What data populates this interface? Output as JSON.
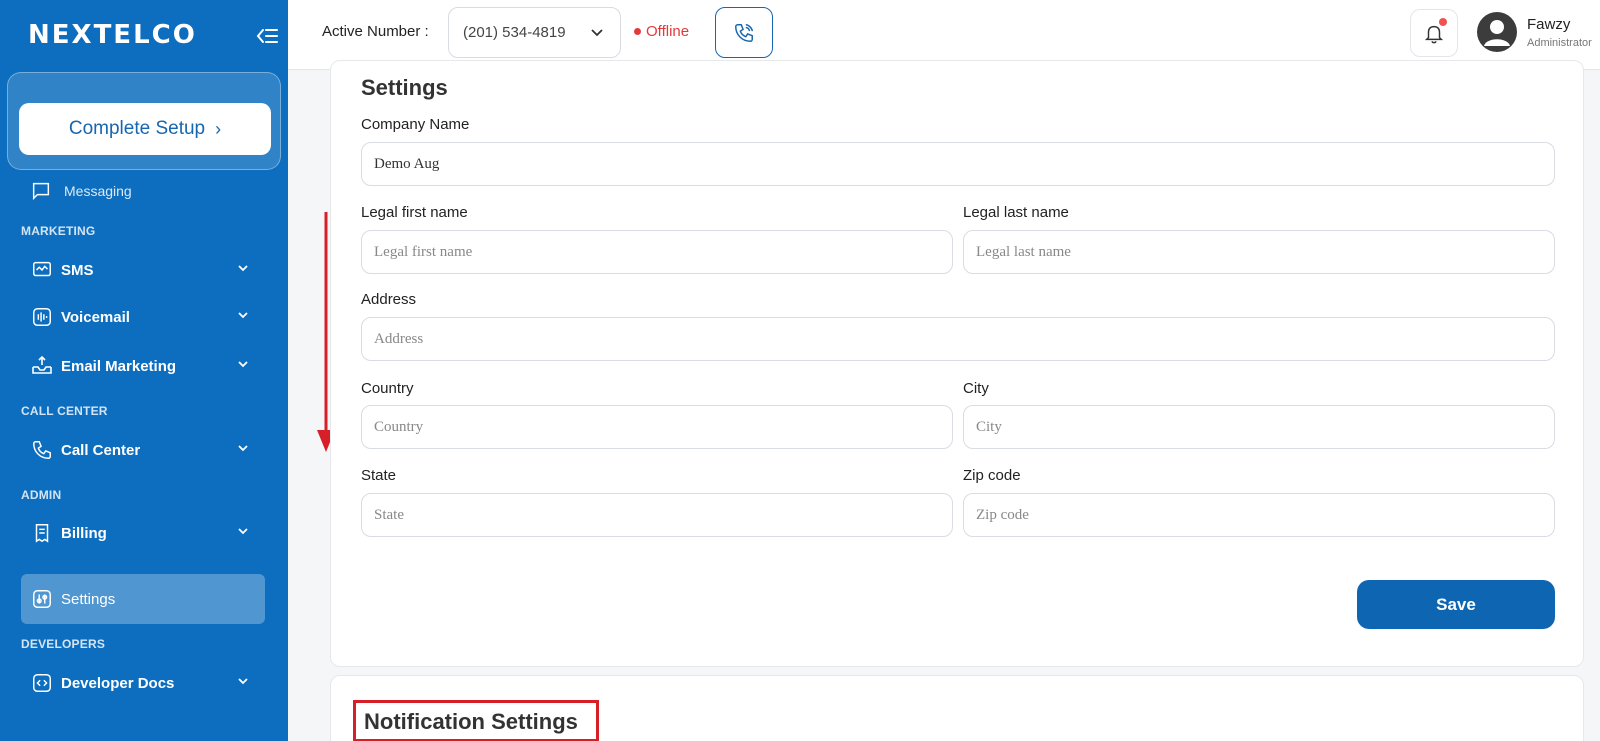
{
  "brand": {
    "logo_text": "NEXTELCO"
  },
  "sidebar": {
    "setup_label": "Complete Setup",
    "partial_item": "Messaging",
    "sections": {
      "marketing": "MARKETING",
      "call_center": "CALL CENTER",
      "admin": "ADMIN",
      "developers": "DEVELOPERS"
    },
    "items": {
      "sms": "SMS",
      "voicemail": "Voicemail",
      "email_marketing": "Email Marketing",
      "call_center": "Call Center",
      "billing": "Billing",
      "settings": "Settings",
      "developer_docs": "Developer Docs"
    }
  },
  "topbar": {
    "active_number_label": "Active Number :",
    "active_number_value": "(201) 534-4819",
    "status": "Offline",
    "user": {
      "name": "Fawzy",
      "role": "Administrator"
    }
  },
  "settings": {
    "title": "Settings",
    "company_name": {
      "label": "Company Name",
      "value": "Demo Aug"
    },
    "legal_first_name": {
      "label": "Legal first name",
      "placeholder": "Legal first name"
    },
    "legal_last_name": {
      "label": "Legal last name",
      "placeholder": "Legal last name"
    },
    "address": {
      "label": "Address",
      "placeholder": "Address"
    },
    "country": {
      "label": "Country",
      "placeholder": "Country"
    },
    "city": {
      "label": "City",
      "placeholder": "City"
    },
    "state": {
      "label": "State",
      "placeholder": "State"
    },
    "zip": {
      "label": "Zip code",
      "placeholder": "Zip code"
    },
    "save_label": "Save"
  },
  "notification_settings": {
    "title": "Notification Settings"
  },
  "colors": {
    "sidebar_bg": "#0d6ebf",
    "primary": "#0e66b3",
    "offline": "#e53939",
    "highlight": "#d71f28"
  }
}
